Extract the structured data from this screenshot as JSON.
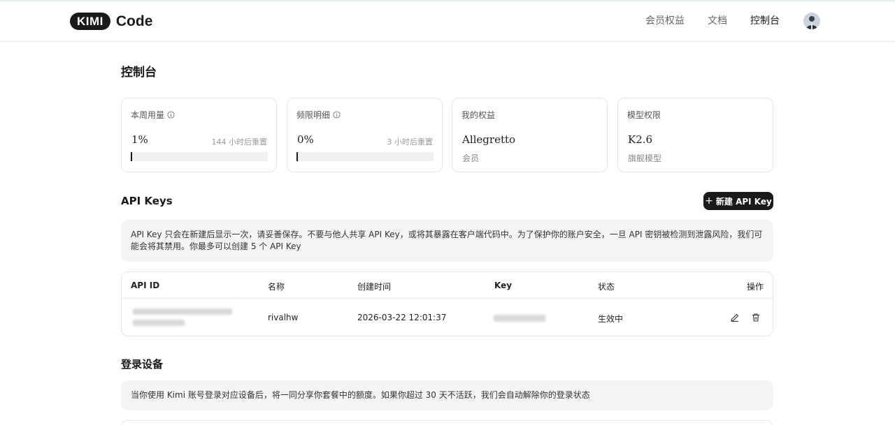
{
  "header": {
    "logo_badge": "KIMI",
    "logo_text": "Code",
    "nav": [
      "会员权益",
      "文档",
      "控制台"
    ]
  },
  "page": {
    "title": "控制台"
  },
  "cards": {
    "usage": {
      "label": "本周用量",
      "value": "1%",
      "reset": "144 小时后重置",
      "progress": 0.01
    },
    "rate": {
      "label": "频限明细",
      "value": "0%",
      "reset": "3 小时后重置",
      "progress": 0.0
    },
    "benefit": {
      "label": "我的权益",
      "value": "Allegretto",
      "sub": "会员"
    },
    "model": {
      "label": "模型权限",
      "value": "K2.6",
      "sub": "旗舰模型"
    }
  },
  "api_keys": {
    "title": "API Keys",
    "new_button": "新建 API Key",
    "notice": "API Key 只会在新建后显示一次，请妥善保存。不要与他人共享 API Key，或将其暴露在客户端代码中。为了保护你的账户安全，一旦 API 密钥被检测到泄露风险，我们可能会将其禁用。你最多可以创建 5 个 API Key",
    "columns": [
      "API ID",
      "名称",
      "创建时间",
      "Key",
      "状态",
      "操作"
    ],
    "rows": [
      {
        "name": "rivalhw",
        "created": "2026-03-22 12:01:37",
        "status": "生效中"
      }
    ]
  },
  "devices": {
    "title": "登录设备",
    "notice": "当你使用 Kimi 账号登录对应设备后，将一同分享你套餐中的额度。如果你超过 30 天不活跃，我们会自动解除你的登录状态"
  },
  "colors": {
    "accent": "#1a1a1a",
    "notice_bg": "#f4f4f4",
    "border": "#e5e5e5"
  }
}
